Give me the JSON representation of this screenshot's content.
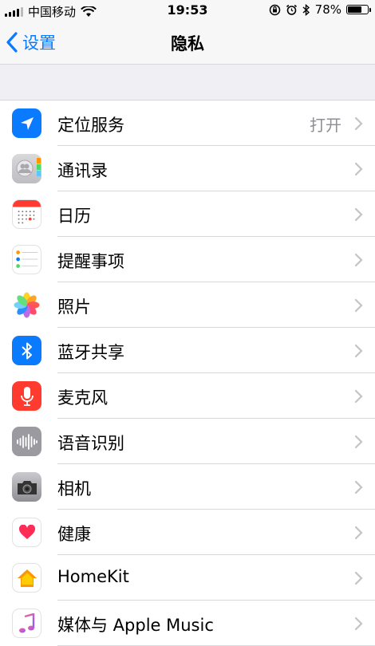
{
  "status_bar": {
    "carrier": "中国移动",
    "time": "19:53",
    "battery_percent": "78%",
    "battery_level": 0.78
  },
  "nav": {
    "back_label": "设置",
    "title": "隐私"
  },
  "items": [
    {
      "label": "定位服务",
      "detail": "打开",
      "icon": "location-arrow-icon",
      "color": "#0a7aff"
    },
    {
      "label": "通讯录",
      "detail": "",
      "icon": "contacts-icon",
      "color": "#c9c9ce"
    },
    {
      "label": "日历",
      "detail": "",
      "icon": "calendar-icon",
      "color": "#ffffff"
    },
    {
      "label": "提醒事项",
      "detail": "",
      "icon": "reminders-icon",
      "color": "#ffffff"
    },
    {
      "label": "照片",
      "detail": "",
      "icon": "photos-icon",
      "color": "#ffffff"
    },
    {
      "label": "蓝牙共享",
      "detail": "",
      "icon": "bluetooth-icon",
      "color": "#0a7aff"
    },
    {
      "label": "麦克风",
      "detail": "",
      "icon": "microphone-icon",
      "color": "#ff3b30"
    },
    {
      "label": "语音识别",
      "detail": "",
      "icon": "speech-recognition-icon",
      "color": "#8e8e93"
    },
    {
      "label": "相机",
      "detail": "",
      "icon": "camera-icon",
      "color": "#8e8e93"
    },
    {
      "label": "健康",
      "detail": "",
      "icon": "health-heart-icon",
      "color": "#ffffff"
    },
    {
      "label": "HomeKit",
      "detail": "",
      "icon": "homekit-icon",
      "color": "#ffffff"
    },
    {
      "label": "媒体与 Apple Music",
      "detail": "",
      "icon": "music-note-icon",
      "color": "#ffffff"
    }
  ]
}
